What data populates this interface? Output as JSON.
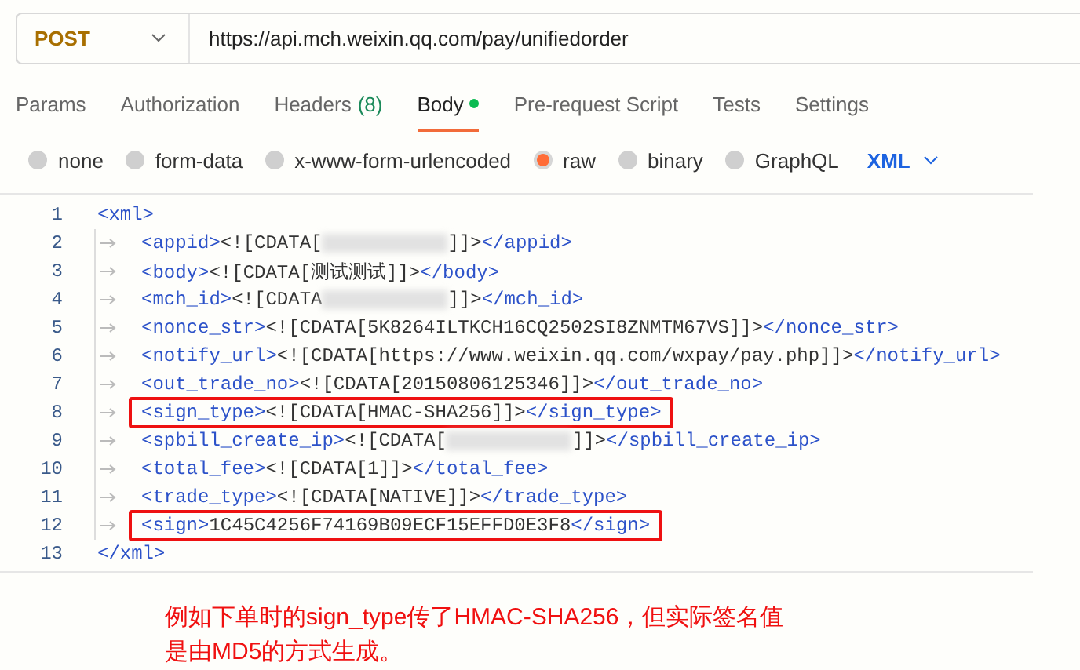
{
  "request": {
    "method": "POST",
    "url": "https://api.mch.weixin.qq.com/pay/unifiedorder"
  },
  "tabs": [
    {
      "label": "Params",
      "selected": false
    },
    {
      "label": "Authorization",
      "selected": false
    },
    {
      "label": "Headers",
      "count": "(8)",
      "selected": false
    },
    {
      "label": "Body",
      "selected": true,
      "has_content": true
    },
    {
      "label": "Pre-request Script",
      "selected": false
    },
    {
      "label": "Tests",
      "selected": false
    },
    {
      "label": "Settings",
      "selected": false
    }
  ],
  "body_types": [
    {
      "label": "none",
      "selected": false
    },
    {
      "label": "form-data",
      "selected": false
    },
    {
      "label": "x-www-form-urlencoded",
      "selected": false
    },
    {
      "label": "raw",
      "selected": true
    },
    {
      "label": "binary",
      "selected": false
    },
    {
      "label": "GraphQL",
      "selected": false
    }
  ],
  "format": "XML",
  "code_lines": [
    {
      "number": "1",
      "highlighted": false,
      "parts": [
        {
          "kind": "tag",
          "text": "<xml>"
        }
      ],
      "children": [
        {
          "number": "2",
          "highlighted": false,
          "parts": [
            {
              "kind": "tag",
              "text": "<appid>"
            },
            {
              "kind": "text",
              "text": "<![CDATA["
            },
            {
              "kind": "redacted"
            },
            {
              "kind": "text",
              "text": "]]>"
            },
            {
              "kind": "tag",
              "text": "</appid>"
            }
          ]
        },
        {
          "number": "3",
          "highlighted": false,
          "parts": [
            {
              "kind": "tag",
              "text": "<body>"
            },
            {
              "kind": "text",
              "text": "<![CDATA[测试测试]]>"
            },
            {
              "kind": "tag",
              "text": "</body>"
            }
          ]
        },
        {
          "number": "4",
          "highlighted": false,
          "parts": [
            {
              "kind": "tag",
              "text": "<mch_id>"
            },
            {
              "kind": "text",
              "text": "<![CDATA"
            },
            {
              "kind": "redacted"
            },
            {
              "kind": "text",
              "text": "]]>"
            },
            {
              "kind": "tag",
              "text": "</mch_id>"
            }
          ]
        },
        {
          "number": "5",
          "highlighted": false,
          "parts": [
            {
              "kind": "tag",
              "text": "<nonce_str>"
            },
            {
              "kind": "text",
              "text": "<![CDATA[5K8264ILTKCH16CQ2502SI8ZNMTM67VS]]>"
            },
            {
              "kind": "tag",
              "text": "</nonce_str>"
            }
          ]
        },
        {
          "number": "6",
          "highlighted": false,
          "parts": [
            {
              "kind": "tag",
              "text": "<notify_url>"
            },
            {
              "kind": "text",
              "text": "<![CDATA[https://www.weixin.qq.com/wxpay/pay.php]]>"
            },
            {
              "kind": "tag",
              "text": "</notify_url>"
            }
          ]
        },
        {
          "number": "7",
          "highlighted": false,
          "parts": [
            {
              "kind": "tag",
              "text": "<out_trade_no>"
            },
            {
              "kind": "text",
              "text": "<![CDATA[20150806125346]]>"
            },
            {
              "kind": "tag",
              "text": "</out_trade_no>"
            }
          ]
        },
        {
          "number": "8",
          "highlighted": true,
          "parts": [
            {
              "kind": "tag",
              "text": "<sign_type>"
            },
            {
              "kind": "text",
              "text": "<![CDATA[HMAC-SHA256]]>"
            },
            {
              "kind": "tag",
              "text": "</sign_type>"
            }
          ]
        },
        {
          "number": "9",
          "highlighted": false,
          "parts": [
            {
              "kind": "tag",
              "text": "<spbill_create_ip>"
            },
            {
              "kind": "text",
              "text": "<![CDATA["
            },
            {
              "kind": "redacted"
            },
            {
              "kind": "text",
              "text": "]]>"
            },
            {
              "kind": "tag",
              "text": "</spbill_create_ip>"
            }
          ]
        },
        {
          "number": "10",
          "highlighted": false,
          "parts": [
            {
              "kind": "tag",
              "text": "<total_fee>"
            },
            {
              "kind": "text",
              "text": "<![CDATA[1]]>"
            },
            {
              "kind": "tag",
              "text": "</total_fee>"
            }
          ]
        },
        {
          "number": "11",
          "highlighted": false,
          "parts": [
            {
              "kind": "tag",
              "text": "<trade_type>"
            },
            {
              "kind": "text",
              "text": "<![CDATA[NATIVE]]>"
            },
            {
              "kind": "tag",
              "text": "</trade_type>"
            }
          ]
        },
        {
          "number": "12",
          "highlighted": true,
          "parts": [
            {
              "kind": "tag",
              "text": "<sign>"
            },
            {
              "kind": "text",
              "text": "1C45C4256F74169B09ECF15EFFD0E3F8"
            },
            {
              "kind": "tag",
              "text": "</sign>"
            }
          ]
        }
      ]
    },
    {
      "number": "13",
      "highlighted": false,
      "parts": [
        {
          "kind": "tag",
          "text": "</xml>"
        }
      ]
    }
  ],
  "annotation": [
    "例如下单时的sign_type传了HMAC-SHA256，但实际签名值",
    "是由MD5的方式生成。"
  ]
}
